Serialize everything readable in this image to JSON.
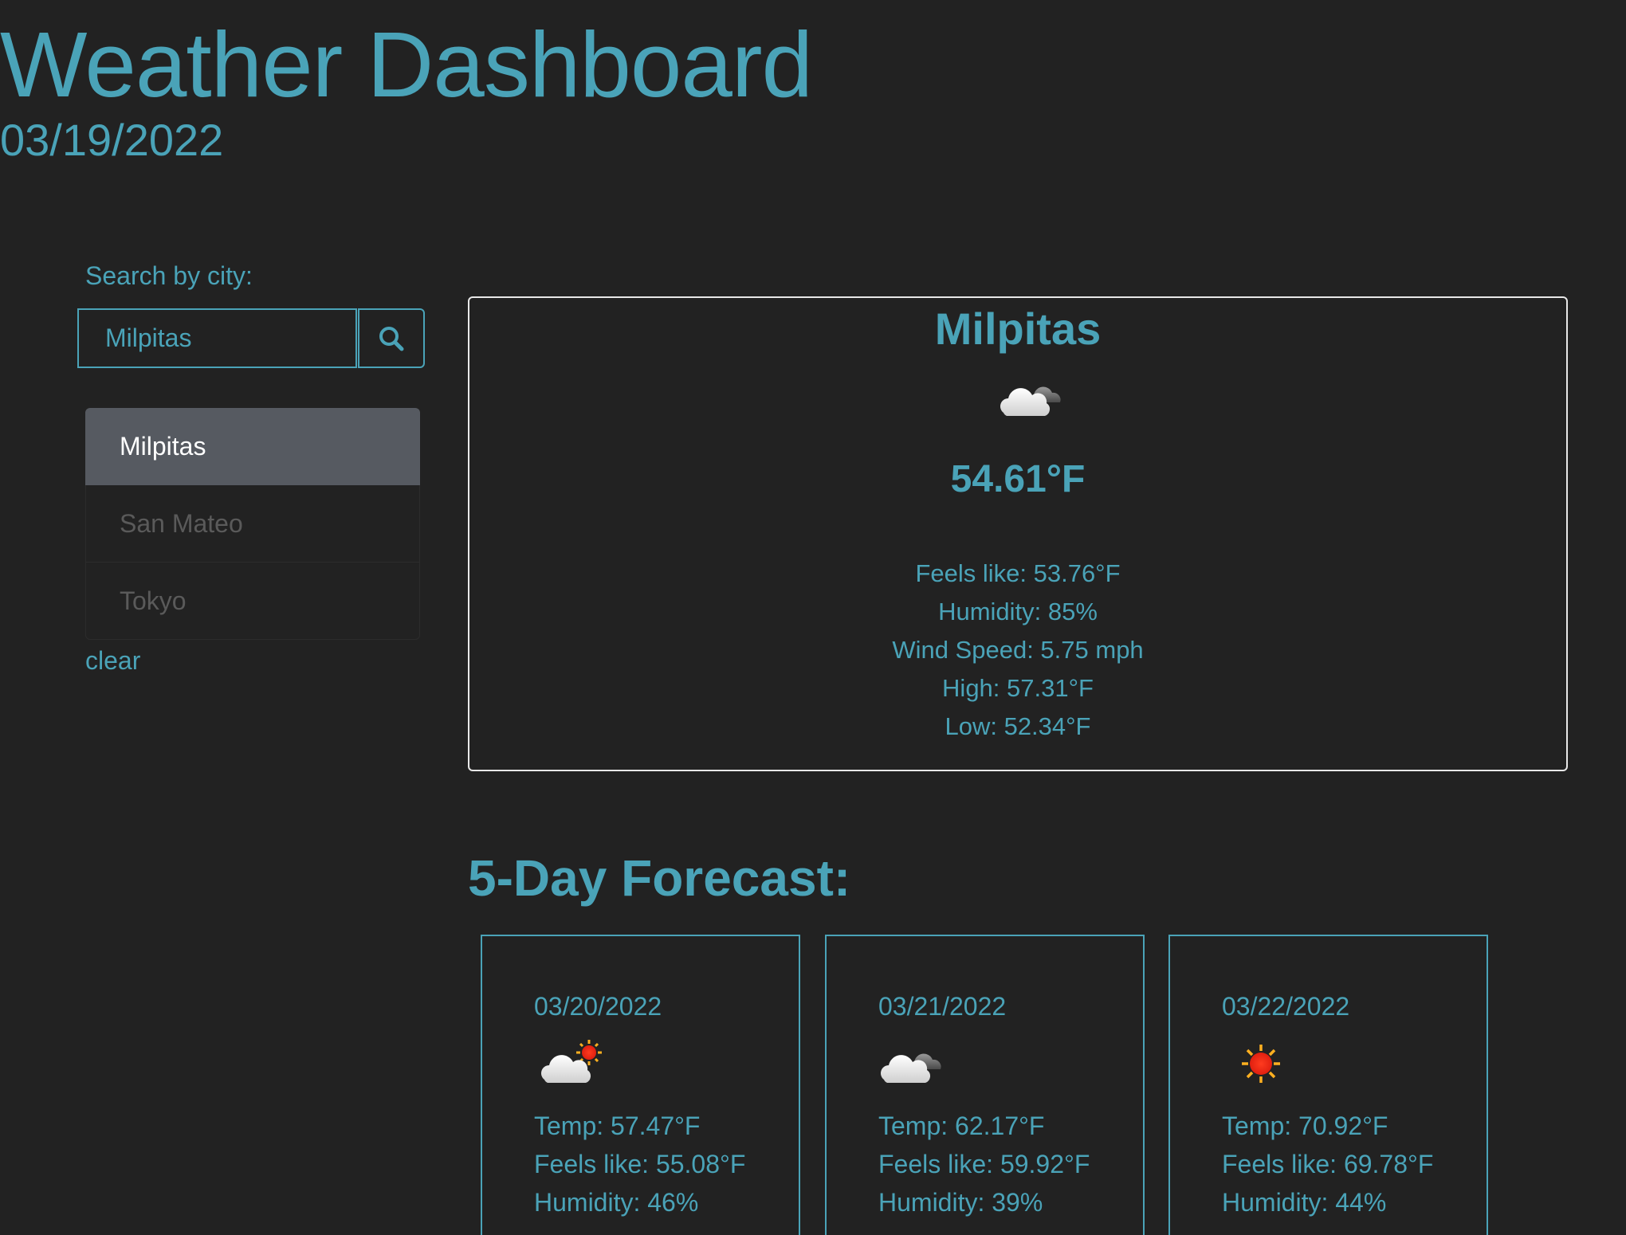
{
  "header": {
    "title": "Weather Dashboard",
    "date": "03/19/2022"
  },
  "sidebar": {
    "search_label": "Search by city:",
    "search_value": "Milpitas",
    "search_button_icon": "search-icon",
    "history": [
      {
        "label": "Milpitas",
        "active": true
      },
      {
        "label": "San Mateo",
        "active": false
      },
      {
        "label": "Tokyo",
        "active": false
      }
    ],
    "clear_label": "clear"
  },
  "current": {
    "city": "Milpitas",
    "icon": "cloud-icon",
    "temp": "54.61°F",
    "details": {
      "feels_like": "Feels like: 53.76°F",
      "humidity": "Humidity: 85%",
      "wind": "Wind Speed: 5.75 mph",
      "high": "High: 57.31°F",
      "low": "Low: 52.34°F"
    }
  },
  "forecast": {
    "title": "5-Day Forecast:",
    "days": [
      {
        "date": "03/20/2022",
        "icon": "partly-sunny-icon",
        "temp": "Temp: 57.47°F",
        "feels_like": "Feels like: 55.08°F",
        "humidity": "Humidity: 46%"
      },
      {
        "date": "03/21/2022",
        "icon": "cloud-icon",
        "temp": "Temp: 62.17°F",
        "feels_like": "Feels like: 59.92°F",
        "humidity": "Humidity: 39%"
      },
      {
        "date": "03/22/2022",
        "icon": "sun-icon",
        "temp": "Temp: 70.92°F",
        "feels_like": "Feels like: 69.78°F",
        "humidity": "Humidity: 44%"
      }
    ]
  },
  "colors": {
    "accent": "#4aa3b8",
    "background": "#222222",
    "active_item": "#565a61"
  }
}
